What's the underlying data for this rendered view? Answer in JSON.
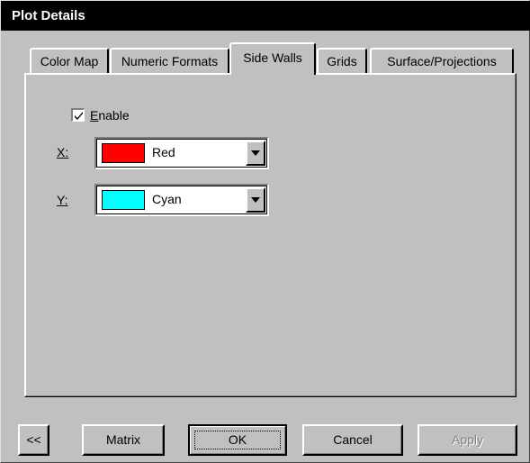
{
  "window": {
    "title": "Plot Details"
  },
  "tabs": [
    {
      "label": "Color Map",
      "active": false
    },
    {
      "label": "Numeric Formats",
      "active": false
    },
    {
      "label": "Side Walls",
      "active": true
    },
    {
      "label": "Grids",
      "active": false
    },
    {
      "label": "Surface/Projections",
      "active": false
    }
  ],
  "side_walls": {
    "enable": {
      "label_underlined": "E",
      "label_rest": "nable",
      "checked": true
    },
    "x": {
      "label": "X:",
      "color_name": "Red",
      "color": "#ff0000"
    },
    "y": {
      "label": "Y:",
      "color_name": "Cyan",
      "color": "#00ffff"
    }
  },
  "buttons": {
    "collapse": "<<",
    "matrix": "Matrix",
    "ok": "OK",
    "cancel": "Cancel",
    "apply": "Apply"
  },
  "icons": {
    "checkmark": "checkmark-icon",
    "dropdown": "dropdown-arrow-icon"
  }
}
